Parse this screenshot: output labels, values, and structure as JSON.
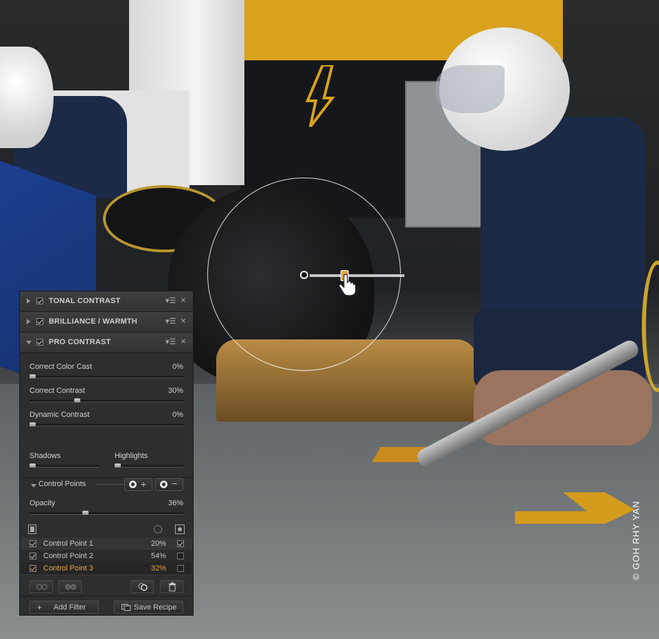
{
  "photo": {
    "copyright": "© GOH RHY YAN"
  },
  "panel": {
    "filters": [
      {
        "title": "TONAL CONTRAST",
        "enabled": true,
        "expanded": false
      },
      {
        "title": "BRILLIANCE / WARMTH",
        "enabled": true,
        "expanded": false
      },
      {
        "title": "PRO CONTRAST",
        "enabled": true,
        "expanded": true
      }
    ],
    "pro_contrast": {
      "sliders": [
        {
          "label": "Correct Color Cast",
          "value": "0%",
          "level": 0
        },
        {
          "label": "Correct Contrast",
          "value": "30%",
          "level": 0.3
        },
        {
          "label": "Dynamic Contrast",
          "value": "0%",
          "level": 0
        }
      ],
      "shadows": {
        "label": "Shadows",
        "level": 0
      },
      "highlights": {
        "label": "Highlights",
        "level": 0
      }
    },
    "control_points": {
      "section_label": "Control Points",
      "opacity_label": "Opacity",
      "opacity_value": "36%",
      "opacity_level": 0.36,
      "items": [
        {
          "name": "Control Point 1",
          "percent": "20%",
          "checked": true,
          "selected": false,
          "visible": true
        },
        {
          "name": "Control Point 2",
          "percent": "54%",
          "checked": true,
          "selected": false,
          "visible": false
        },
        {
          "name": "Control Point 3",
          "percent": "32%",
          "checked": true,
          "selected": true,
          "visible": false
        }
      ]
    },
    "footer": {
      "add_filter": "Add Filter",
      "save_recipe": "Save Recipe"
    }
  },
  "colors": {
    "panel_bg": "#2e2e2e",
    "accent": "#e8a63b"
  }
}
